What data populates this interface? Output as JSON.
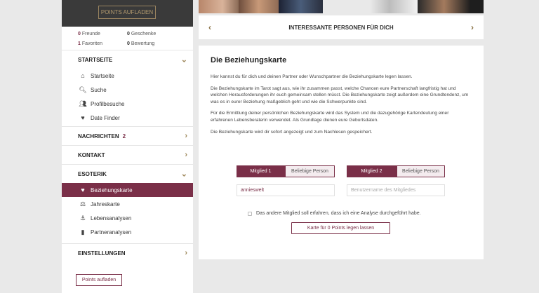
{
  "sidebar": {
    "top_button": "POINTS AUFLADEN",
    "stats": [
      {
        "count": "0",
        "label": "Freunde"
      },
      {
        "count": "0",
        "label": "Geschenke"
      },
      {
        "count": "1",
        "label": "Favoriten"
      },
      {
        "count": "0",
        "label": "Bewertung"
      }
    ],
    "sections": {
      "startseite": "STARTSEITE",
      "nachrichten": "NACHRICHTEN",
      "nachrichten_count": "2",
      "kontakt": "KONTAKT",
      "esoterik": "ESOTERIK",
      "einstellungen": "EINSTELLUNGEN"
    },
    "start_items": [
      "Startseite",
      "Suche",
      "Profilbesuche",
      "Date Finder"
    ],
    "esoterik_items": [
      "Beziehungskarte",
      "Jahreskarte",
      "Lebensanalysen",
      "Partneranalysen"
    ],
    "bottom_button": "Points aufladen"
  },
  "people_bar": {
    "title": "INTERESSANTE PERSONEN FÜR DICH",
    "prev": "‹",
    "next": "›"
  },
  "main": {
    "title": "Die Beziehungskarte",
    "paragraphs": [
      "Hier kannst du für dich und deinen Partner oder Wunschpartner die Beziehungskarte legen lassen.",
      "Die Beziehungskarte im Tarot sagt aus, wie ihr zusammen passt, welche Chancen eure Partnerschaft langfristig hat und welchen Herausforderungen ihr euch gemeinsam stellen müsst. Die Beziehungskarte zeigt außerdem eine Grundtendenz, um was es in eurer Beziehung maßgeblich geht und wie die Schwerpunkte sind.",
      "Für die Ermittlung deiner persönlichen Beziehungskarte wird das System und die dazugehörige Kartendeutung einer erfahrenen Lebensberaterin verwendet. Als Grundlage dienen eure Geburtsdaten.",
      "Die Beziehungskarte wird dir sofort angezeigt und zum Nachlesen gespeichert."
    ],
    "member1_tab": "Mitglied 1",
    "member1_alt_tab": "Beliebige Person",
    "member1_value": "annieswelt",
    "member2_tab": "Mitglied 2",
    "member2_alt_tab": "Beliebige Person",
    "member2_placeholder": "Benutzername des Mitgliedes",
    "notify_label": "Das andere Mitglied soll erfahren, dass ich eine Analyse durchgeführt habe.",
    "submit_label": "Karte für 0 Points legen lassen"
  },
  "colors": {
    "accent": "#7a2f48",
    "gold": "#a08a5e"
  }
}
